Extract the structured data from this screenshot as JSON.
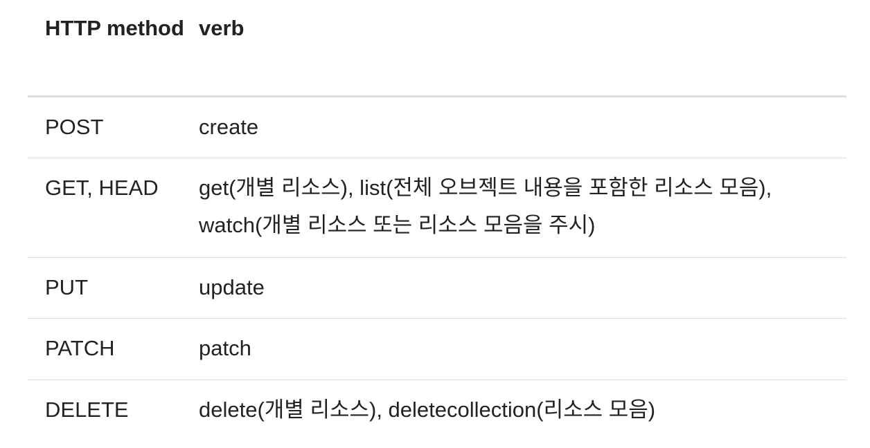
{
  "table": {
    "headers": [
      "HTTP method",
      "verb"
    ],
    "rows": [
      {
        "method": "POST",
        "verb": "create"
      },
      {
        "method": "GET, HEAD",
        "verb": "get(개별 리소스), list(전체 오브젝트 내용을 포함한 리소스 모음), watch(개별 리소스 또는 리소스 모음을 주시)"
      },
      {
        "method": "PUT",
        "verb": "update"
      },
      {
        "method": "PATCH",
        "verb": "patch"
      },
      {
        "method": "DELETE",
        "verb": "delete(개별 리소스), deletecollection(리소스 모음)"
      }
    ]
  }
}
